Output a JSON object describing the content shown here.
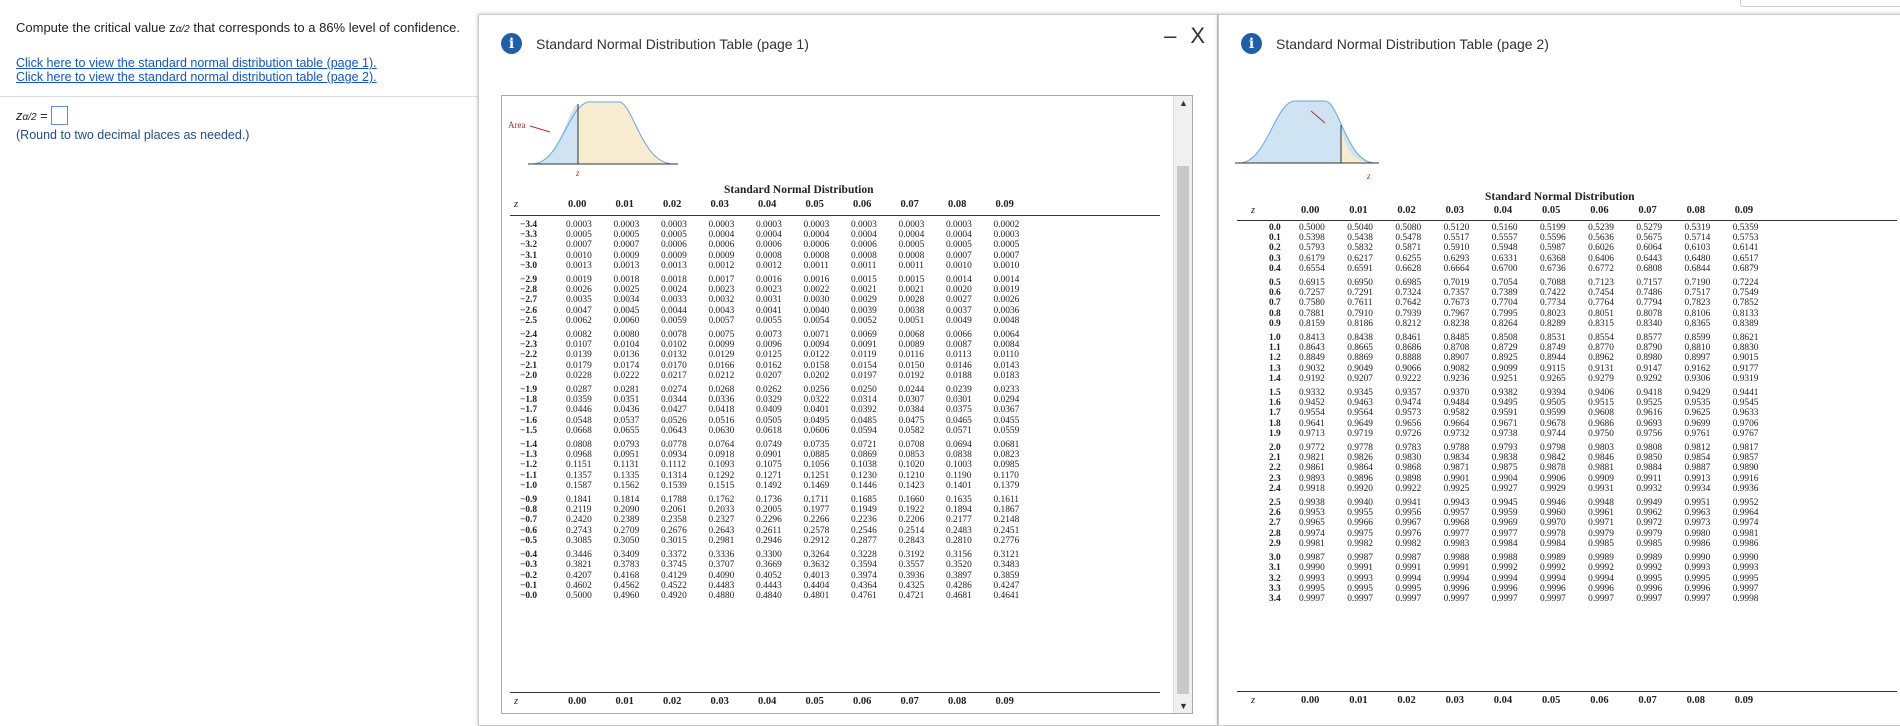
{
  "question": {
    "prefix": "Compute the critical value z",
    "sub": "α/2",
    "suffix": " that corresponds to a 86% level of confidence."
  },
  "links": [
    "Click here to view the standard normal distribution table (page 1).",
    "Click here to view the standard normal distribution table (page 2)."
  ],
  "answer": {
    "label_main": "z",
    "label_sub": "α/2",
    "label_eq": " ="
  },
  "note": "(Round to two decimal places as needed.)",
  "dialogs": {
    "page1_title": "Standard Normal Distribution Table (page 1)",
    "page2_title": "Standard Normal Distribution Table (page 2)",
    "minimize": "–",
    "close": "X"
  },
  "figure": {
    "area_label": "Area",
    "z_label": "z"
  },
  "table_title_line1": "Standard Normal Distribution",
  "z_header": "z",
  "columns": [
    "0.00",
    "0.01",
    "0.02",
    "0.03",
    "0.04",
    "0.05",
    "0.06",
    "0.07",
    "0.08",
    "0.09"
  ],
  "page1_rows": [
    [
      "−3.4",
      "0.0003",
      "0.0003",
      "0.0003",
      "0.0003",
      "0.0003",
      "0.0003",
      "0.0003",
      "0.0003",
      "0.0003",
      "0.0002"
    ],
    [
      "−3.3",
      "0.0005",
      "0.0005",
      "0.0005",
      "0.0004",
      "0.0004",
      "0.0004",
      "0.0004",
      "0.0004",
      "0.0004",
      "0.0003"
    ],
    [
      "−3.2",
      "0.0007",
      "0.0007",
      "0.0006",
      "0.0006",
      "0.0006",
      "0.0006",
      "0.0006",
      "0.0005",
      "0.0005",
      "0.0005"
    ],
    [
      "−3.1",
      "0.0010",
      "0.0009",
      "0.0009",
      "0.0009",
      "0.0008",
      "0.0008",
      "0.0008",
      "0.0008",
      "0.0007",
      "0.0007"
    ],
    [
      "−3.0",
      "0.0013",
      "0.0013",
      "0.0013",
      "0.0012",
      "0.0012",
      "0.0011",
      "0.0011",
      "0.0011",
      "0.0010",
      "0.0010"
    ],
    [
      "−2.9",
      "0.0019",
      "0.0018",
      "0.0018",
      "0.0017",
      "0.0016",
      "0.0016",
      "0.0015",
      "0.0015",
      "0.0014",
      "0.0014"
    ],
    [
      "−2.8",
      "0.0026",
      "0.0025",
      "0.0024",
      "0.0023",
      "0.0023",
      "0.0022",
      "0.0021",
      "0.0021",
      "0.0020",
      "0.0019"
    ],
    [
      "−2.7",
      "0.0035",
      "0.0034",
      "0.0033",
      "0.0032",
      "0.0031",
      "0.0030",
      "0.0029",
      "0.0028",
      "0.0027",
      "0.0026"
    ],
    [
      "−2.6",
      "0.0047",
      "0.0045",
      "0.0044",
      "0.0043",
      "0.0041",
      "0.0040",
      "0.0039",
      "0.0038",
      "0.0037",
      "0.0036"
    ],
    [
      "−2.5",
      "0.0062",
      "0.0060",
      "0.0059",
      "0.0057",
      "0.0055",
      "0.0054",
      "0.0052",
      "0.0051",
      "0.0049",
      "0.0048"
    ],
    [
      "−2.4",
      "0.0082",
      "0.0080",
      "0.0078",
      "0.0075",
      "0.0073",
      "0.0071",
      "0.0069",
      "0.0068",
      "0.0066",
      "0.0064"
    ],
    [
      "−2.3",
      "0.0107",
      "0.0104",
      "0.0102",
      "0.0099",
      "0.0096",
      "0.0094",
      "0.0091",
      "0.0089",
      "0.0087",
      "0.0084"
    ],
    [
      "−2.2",
      "0.0139",
      "0.0136",
      "0.0132",
      "0.0129",
      "0.0125",
      "0.0122",
      "0.0119",
      "0.0116",
      "0.0113",
      "0.0110"
    ],
    [
      "−2.1",
      "0.0179",
      "0.0174",
      "0.0170",
      "0.0166",
      "0.0162",
      "0.0158",
      "0.0154",
      "0.0150",
      "0.0146",
      "0.0143"
    ],
    [
      "−2.0",
      "0.0228",
      "0.0222",
      "0.0217",
      "0.0212",
      "0.0207",
      "0.0202",
      "0.0197",
      "0.0192",
      "0.0188",
      "0.0183"
    ],
    [
      "−1.9",
      "0.0287",
      "0.0281",
      "0.0274",
      "0.0268",
      "0.0262",
      "0.0256",
      "0.0250",
      "0.0244",
      "0.0239",
      "0.0233"
    ],
    [
      "−1.8",
      "0.0359",
      "0.0351",
      "0.0344",
      "0.0336",
      "0.0329",
      "0.0322",
      "0.0314",
      "0.0307",
      "0.0301",
      "0.0294"
    ],
    [
      "−1.7",
      "0.0446",
      "0.0436",
      "0.0427",
      "0.0418",
      "0.0409",
      "0.0401",
      "0.0392",
      "0.0384",
      "0.0375",
      "0.0367"
    ],
    [
      "−1.6",
      "0.0548",
      "0.0537",
      "0.0526",
      "0.0516",
      "0.0505",
      "0.0495",
      "0.0485",
      "0.0475",
      "0.0465",
      "0.0455"
    ],
    [
      "−1.5",
      "0.0668",
      "0.0655",
      "0.0643",
      "0.0630",
      "0.0618",
      "0.0606",
      "0.0594",
      "0.0582",
      "0.0571",
      "0.0559"
    ],
    [
      "−1.4",
      "0.0808",
      "0.0793",
      "0.0778",
      "0.0764",
      "0.0749",
      "0.0735",
      "0.0721",
      "0.0708",
      "0.0694",
      "0.0681"
    ],
    [
      "−1.3",
      "0.0968",
      "0.0951",
      "0.0934",
      "0.0918",
      "0.0901",
      "0.0885",
      "0.0869",
      "0.0853",
      "0.0838",
      "0.0823"
    ],
    [
      "−1.2",
      "0.1151",
      "0.1131",
      "0.1112",
      "0.1093",
      "0.1075",
      "0.1056",
      "0.1038",
      "0.1020",
      "0.1003",
      "0.0985"
    ],
    [
      "−1.1",
      "0.1357",
      "0.1335",
      "0.1314",
      "0.1292",
      "0.1271",
      "0.1251",
      "0.1230",
      "0.1210",
      "0.1190",
      "0.1170"
    ],
    [
      "−1.0",
      "0.1587",
      "0.1562",
      "0.1539",
      "0.1515",
      "0.1492",
      "0.1469",
      "0.1446",
      "0.1423",
      "0.1401",
      "0.1379"
    ],
    [
      "−0.9",
      "0.1841",
      "0.1814",
      "0.1788",
      "0.1762",
      "0.1736",
      "0.1711",
      "0.1685",
      "0.1660",
      "0.1635",
      "0.1611"
    ],
    [
      "−0.8",
      "0.2119",
      "0.2090",
      "0.2061",
      "0.2033",
      "0.2005",
      "0.1977",
      "0.1949",
      "0.1922",
      "0.1894",
      "0.1867"
    ],
    [
      "−0.7",
      "0.2420",
      "0.2389",
      "0.2358",
      "0.2327",
      "0.2296",
      "0.2266",
      "0.2236",
      "0.2206",
      "0.2177",
      "0.2148"
    ],
    [
      "−0.6",
      "0.2743",
      "0.2709",
      "0.2676",
      "0.2643",
      "0.2611",
      "0.2578",
      "0.2546",
      "0.2514",
      "0.2483",
      "0.2451"
    ],
    [
      "−0.5",
      "0.3085",
      "0.3050",
      "0.3015",
      "0.2981",
      "0.2946",
      "0.2912",
      "0.2877",
      "0.2843",
      "0.2810",
      "0.2776"
    ],
    [
      "−0.4",
      "0.3446",
      "0.3409",
      "0.3372",
      "0.3336",
      "0.3300",
      "0.3264",
      "0.3228",
      "0.3192",
      "0.3156",
      "0.3121"
    ],
    [
      "−0.3",
      "0.3821",
      "0.3783",
      "0.3745",
      "0.3707",
      "0.3669",
      "0.3632",
      "0.3594",
      "0.3557",
      "0.3520",
      "0.3483"
    ],
    [
      "−0.2",
      "0.4207",
      "0.4168",
      "0.4129",
      "0.4090",
      "0.4052",
      "0.4013",
      "0.3974",
      "0.3936",
      "0.3897",
      "0.3859"
    ],
    [
      "−0.1",
      "0.4602",
      "0.4562",
      "0.4522",
      "0.4483",
      "0.4443",
      "0.4404",
      "0.4364",
      "0.4325",
      "0.4286",
      "0.4247"
    ],
    [
      "−0.0",
      "0.5000",
      "0.4960",
      "0.4920",
      "0.4880",
      "0.4840",
      "0.4801",
      "0.4761",
      "0.4721",
      "0.4681",
      "0.4641"
    ]
  ],
  "page2_rows": [
    [
      "0.0",
      "0.5000",
      "0.5040",
      "0.5080",
      "0.5120",
      "0.5160",
      "0.5199",
      "0.5239",
      "0.5279",
      "0.5319",
      "0.5359"
    ],
    [
      "0.1",
      "0.5398",
      "0.5438",
      "0.5478",
      "0.5517",
      "0.5557",
      "0.5596",
      "0.5636",
      "0.5675",
      "0.5714",
      "0.5753"
    ],
    [
      "0.2",
      "0.5793",
      "0.5832",
      "0.5871",
      "0.5910",
      "0.5948",
      "0.5987",
      "0.6026",
      "0.6064",
      "0.6103",
      "0.6141"
    ],
    [
      "0.3",
      "0.6179",
      "0.6217",
      "0.6255",
      "0.6293",
      "0.6331",
      "0.6368",
      "0.6406",
      "0.6443",
      "0.6480",
      "0.6517"
    ],
    [
      "0.4",
      "0.6554",
      "0.6591",
      "0.6628",
      "0.6664",
      "0.6700",
      "0.6736",
      "0.6772",
      "0.6808",
      "0.6844",
      "0.6879"
    ],
    [
      "0.5",
      "0.6915",
      "0.6950",
      "0.6985",
      "0.7019",
      "0.7054",
      "0.7088",
      "0.7123",
      "0.7157",
      "0.7190",
      "0.7224"
    ],
    [
      "0.6",
      "0.7257",
      "0.7291",
      "0.7324",
      "0.7357",
      "0.7389",
      "0.7422",
      "0.7454",
      "0.7486",
      "0.7517",
      "0.7549"
    ],
    [
      "0.7",
      "0.7580",
      "0.7611",
      "0.7642",
      "0.7673",
      "0.7704",
      "0.7734",
      "0.7764",
      "0.7794",
      "0.7823",
      "0.7852"
    ],
    [
      "0.8",
      "0.7881",
      "0.7910",
      "0.7939",
      "0.7967",
      "0.7995",
      "0.8023",
      "0.8051",
      "0.8078",
      "0.8106",
      "0.8133"
    ],
    [
      "0.9",
      "0.8159",
      "0.8186",
      "0.8212",
      "0.8238",
      "0.8264",
      "0.8289",
      "0.8315",
      "0.8340",
      "0.8365",
      "0.8389"
    ],
    [
      "1.0",
      "0.8413",
      "0.8438",
      "0.8461",
      "0.8485",
      "0.8508",
      "0.8531",
      "0.8554",
      "0.8577",
      "0.8599",
      "0.8621"
    ],
    [
      "1.1",
      "0.8643",
      "0.8665",
      "0.8686",
      "0.8708",
      "0.8729",
      "0.8749",
      "0.8770",
      "0.8790",
      "0.8810",
      "0.8830"
    ],
    [
      "1.2",
      "0.8849",
      "0.8869",
      "0.8888",
      "0.8907",
      "0.8925",
      "0.8944",
      "0.8962",
      "0.8980",
      "0.8997",
      "0.9015"
    ],
    [
      "1.3",
      "0.9032",
      "0.9049",
      "0.9066",
      "0.9082",
      "0.9099",
      "0.9115",
      "0.9131",
      "0.9147",
      "0.9162",
      "0.9177"
    ],
    [
      "1.4",
      "0.9192",
      "0.9207",
      "0.9222",
      "0.9236",
      "0.9251",
      "0.9265",
      "0.9279",
      "0.9292",
      "0.9306",
      "0.9319"
    ],
    [
      "1.5",
      "0.9332",
      "0.9345",
      "0.9357",
      "0.9370",
      "0.9382",
      "0.9394",
      "0.9406",
      "0.9418",
      "0.9429",
      "0.9441"
    ],
    [
      "1.6",
      "0.9452",
      "0.9463",
      "0.9474",
      "0.9484",
      "0.9495",
      "0.9505",
      "0.9515",
      "0.9525",
      "0.9535",
      "0.9545"
    ],
    [
      "1.7",
      "0.9554",
      "0.9564",
      "0.9573",
      "0.9582",
      "0.9591",
      "0.9599",
      "0.9608",
      "0.9616",
      "0.9625",
      "0.9633"
    ],
    [
      "1.8",
      "0.9641",
      "0.9649",
      "0.9656",
      "0.9664",
      "0.9671",
      "0.9678",
      "0.9686",
      "0.9693",
      "0.9699",
      "0.9706"
    ],
    [
      "1.9",
      "0.9713",
      "0.9719",
      "0.9726",
      "0.9732",
      "0.9738",
      "0.9744",
      "0.9750",
      "0.9756",
      "0.9761",
      "0.9767"
    ],
    [
      "2.0",
      "0.9772",
      "0.9778",
      "0.9783",
      "0.9788",
      "0.9793",
      "0.9798",
      "0.9803",
      "0.9808",
      "0.9812",
      "0.9817"
    ],
    [
      "2.1",
      "0.9821",
      "0.9826",
      "0.9830",
      "0.9834",
      "0.9838",
      "0.9842",
      "0.9846",
      "0.9850",
      "0.9854",
      "0.9857"
    ],
    [
      "2.2",
      "0.9861",
      "0.9864",
      "0.9868",
      "0.9871",
      "0.9875",
      "0.9878",
      "0.9881",
      "0.9884",
      "0.9887",
      "0.9890"
    ],
    [
      "2.3",
      "0.9893",
      "0.9896",
      "0.9898",
      "0.9901",
      "0.9904",
      "0.9906",
      "0.9909",
      "0.9911",
      "0.9913",
      "0.9916"
    ],
    [
      "2.4",
      "0.9918",
      "0.9920",
      "0.9922",
      "0.9925",
      "0.9927",
      "0.9929",
      "0.9931",
      "0.9932",
      "0.9934",
      "0.9936"
    ],
    [
      "2.5",
      "0.9938",
      "0.9940",
      "0.9941",
      "0.9943",
      "0.9945",
      "0.9946",
      "0.9948",
      "0.9949",
      "0.9951",
      "0.9952"
    ],
    [
      "2.6",
      "0.9953",
      "0.9955",
      "0.9956",
      "0.9957",
      "0.9959",
      "0.9960",
      "0.9961",
      "0.9962",
      "0.9963",
      "0.9964"
    ],
    [
      "2.7",
      "0.9965",
      "0.9966",
      "0.9967",
      "0.9968",
      "0.9969",
      "0.9970",
      "0.9971",
      "0.9972",
      "0.9973",
      "0.9974"
    ],
    [
      "2.8",
      "0.9974",
      "0.9975",
      "0.9976",
      "0.9977",
      "0.9977",
      "0.9978",
      "0.9979",
      "0.9979",
      "0.9980",
      "0.9981"
    ],
    [
      "2.9",
      "0.9981",
      "0.9982",
      "0.9982",
      "0.9983",
      "0.9984",
      "0.9984",
      "0.9985",
      "0.9985",
      "0.9986",
      "0.9986"
    ],
    [
      "3.0",
      "0.9987",
      "0.9987",
      "0.9987",
      "0.9988",
      "0.9988",
      "0.9989",
      "0.9989",
      "0.9989",
      "0.9990",
      "0.9990"
    ],
    [
      "3.1",
      "0.9990",
      "0.9991",
      "0.9991",
      "0.9991",
      "0.9992",
      "0.9992",
      "0.9992",
      "0.9992",
      "0.9993",
      "0.9993"
    ],
    [
      "3.2",
      "0.9993",
      "0.9993",
      "0.9994",
      "0.9994",
      "0.9994",
      "0.9994",
      "0.9994",
      "0.9995",
      "0.9995",
      "0.9995"
    ],
    [
      "3.3",
      "0.9995",
      "0.9995",
      "0.9995",
      "0.9996",
      "0.9996",
      "0.9996",
      "0.9996",
      "0.9996",
      "0.9996",
      "0.9997"
    ],
    [
      "3.4",
      "0.9997",
      "0.9997",
      "0.9997",
      "0.9997",
      "0.9997",
      "0.9997",
      "0.9997",
      "0.9997",
      "0.9997",
      "0.9998"
    ]
  ],
  "colors": {
    "link": "#1155cc",
    "info_icon": "#1f5fa8",
    "curve_fill": "#f7eccf",
    "curve_stroke": "#6aa6d8",
    "area_marker": "#b03030"
  }
}
